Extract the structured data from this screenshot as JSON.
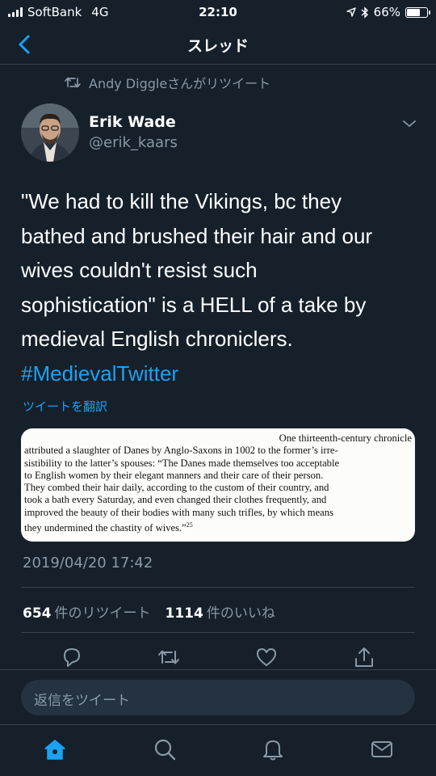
{
  "status_bar": {
    "carrier": "SoftBank",
    "network": "4G",
    "time": "22:10",
    "battery": "66%",
    "battery_level": 0.66
  },
  "nav": {
    "title": "スレッド"
  },
  "retweet_by": "Andy Diggleさんがリツイート",
  "tweet": {
    "author_name": "Erik Wade",
    "author_handle": "@erik_kaars",
    "text_lines": [
      "\"We had to kill the Vikings, bc they",
      "bathed and brushed their hair and our",
      "wives couldn't resist such",
      "sophistication\" is a HELL of a take by",
      "medieval English chroniclers."
    ],
    "hashtag": "#MedievalTwitter",
    "translate_label": "ツイートを翻訳",
    "quote_lines": [
      "One thirteenth-century chronicle",
      "attributed a slaughter of Danes by Anglo-Saxons in 1002 to the former’s irre-",
      "sistibility to the latter’s spouses: “The Danes made themselves too acceptable",
      "to English women by their elegant manners and their care of their person.",
      "They combed their hair daily, according to the custom of their country, and",
      "took a bath every Saturday, and even changed their clothes frequently, and",
      "improved the beauty of their bodies with many such trifles, by which means",
      "they undermined the chastity of wives.”"
    ],
    "quote_footnote": "25",
    "timestamp": "2019/04/20 17:42",
    "retweet_count": "654",
    "retweet_label": "件のリツイート",
    "like_count": "1114",
    "like_label": "件のいいね"
  },
  "reply": {
    "placeholder": "返信をツイート"
  },
  "colors": {
    "background": "#15202b",
    "accent": "#1da1f2",
    "secondary_text": "#8899a6",
    "border": "#38444d"
  },
  "icons": {
    "back": "chevron-left-icon",
    "retweet": "retweet-icon",
    "caret": "chevron-down-icon",
    "reply": "reply-icon",
    "like": "heart-icon",
    "share": "share-icon",
    "home": "home-icon",
    "search": "search-icon",
    "notifications": "bell-icon",
    "messages": "mail-icon"
  }
}
